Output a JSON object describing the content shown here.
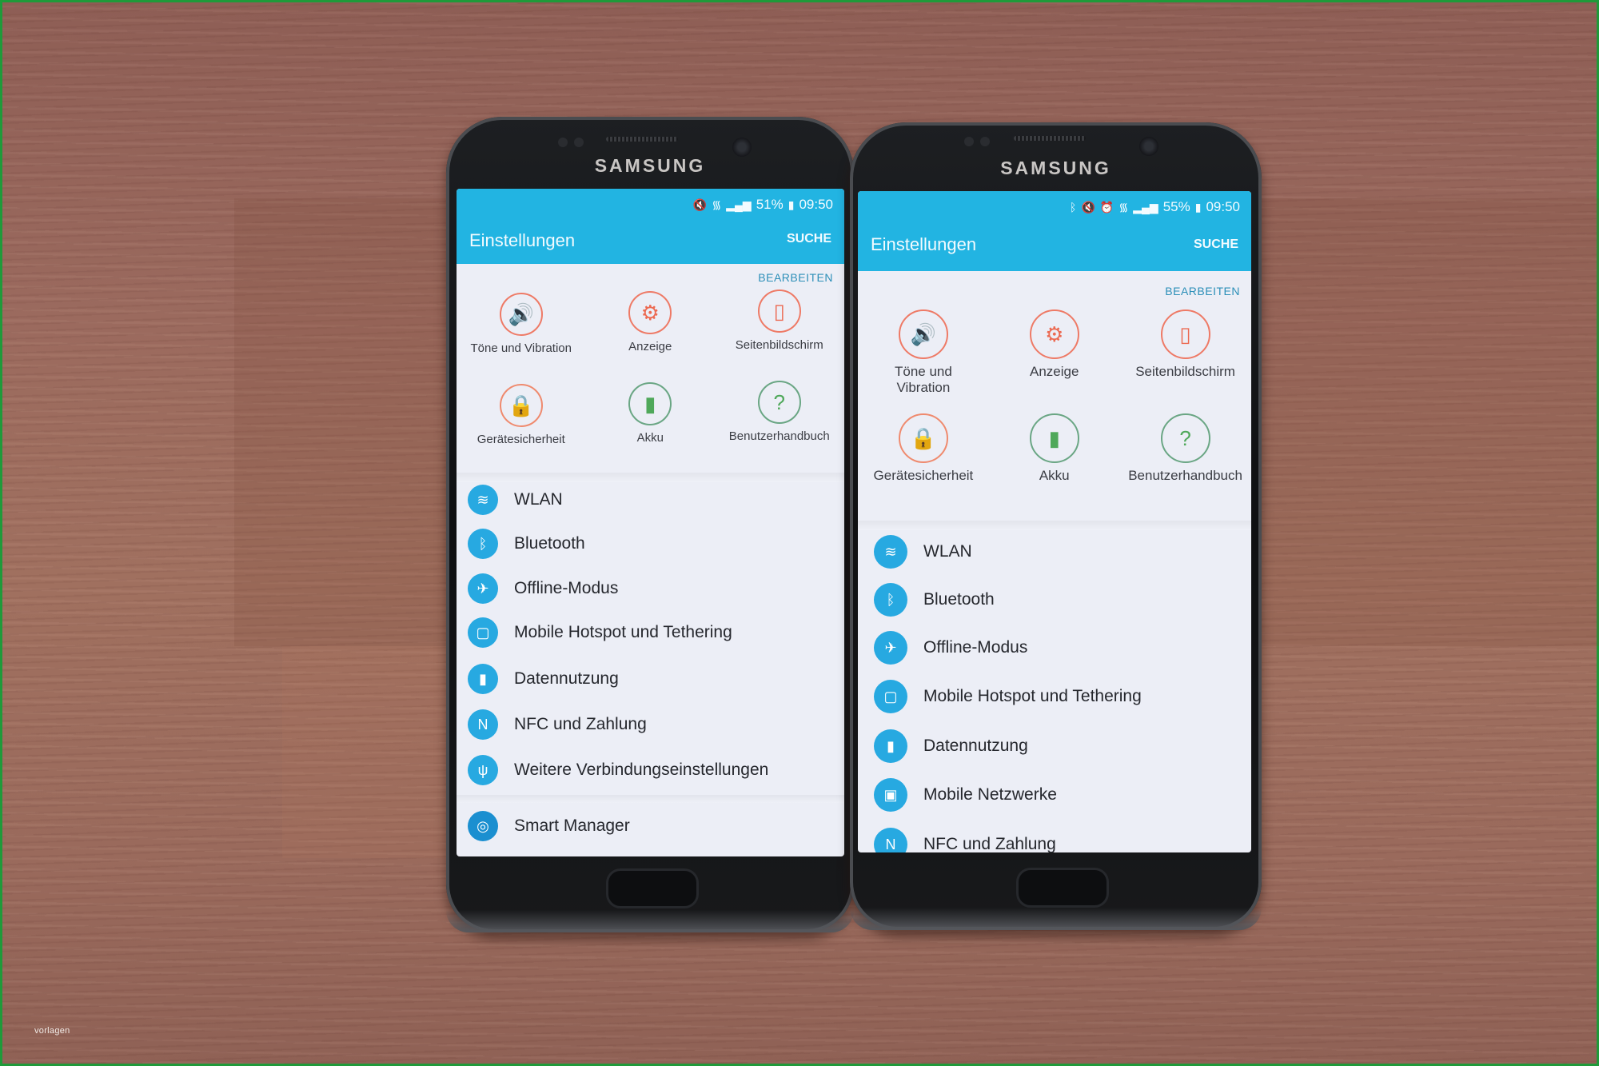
{
  "watermark": "vorlagen",
  "phones": [
    {
      "brand": "SAMSUNG",
      "status": {
        "icons": [
          "mute-icon",
          "wifi-icon",
          "signal-icon"
        ],
        "icon_glyphs": [
          "🔇",
          "᯾",
          "▂▄▆"
        ],
        "battery": "51%",
        "battery_icon": "▮",
        "time": "09:50"
      },
      "appbar": {
        "title": "Einstellungen",
        "search": "SUCHE"
      },
      "edit_label": "BEARBEITEN",
      "quick_settings": [
        {
          "label": "Töne und Vibration",
          "icon": "speaker-icon",
          "glyph": "🔊",
          "style": "orange"
        },
        {
          "label": "Anzeige",
          "icon": "display-icon",
          "glyph": "⚙",
          "style": "orange"
        },
        {
          "label": "Seitenbildschirm",
          "icon": "edge-screen-icon",
          "glyph": "▯",
          "style": "orange"
        },
        {
          "label": "Gerätesicherheit",
          "icon": "lock-icon",
          "glyph": "🔒",
          "style": "lockc"
        },
        {
          "label": "Akku",
          "icon": "battery-icon",
          "glyph": "▮",
          "style": "green"
        },
        {
          "label": "Benutzerhandbuch",
          "icon": "help-book-icon",
          "glyph": "?",
          "style": "green"
        }
      ],
      "settings": [
        {
          "label": "WLAN",
          "icon": "wifi-icon",
          "glyph": "≋"
        },
        {
          "label": "Bluetooth",
          "icon": "bluetooth-icon",
          "glyph": "ᛒ"
        },
        {
          "label": "Offline-Modus",
          "icon": "airplane-icon",
          "glyph": "✈"
        },
        {
          "label": "Mobile Hotspot und Tethering",
          "icon": "hotspot-icon",
          "glyph": "▢"
        },
        {
          "label": "Datennutzung",
          "icon": "data-usage-icon",
          "glyph": "▮"
        },
        {
          "label": "NFC und Zahlung",
          "icon": "nfc-icon",
          "glyph": "N"
        },
        {
          "label": "Weitere Verbindungseinstellungen",
          "icon": "antenna-icon",
          "glyph": "ψ"
        },
        {
          "label": "Smart Manager",
          "icon": "smart-manager-icon",
          "glyph": "◎"
        }
      ]
    },
    {
      "brand": "SAMSUNG",
      "status": {
        "icons": [
          "bluetooth-icon",
          "mute-icon",
          "alarm-icon",
          "wifi-icon",
          "signal-icon"
        ],
        "icon_glyphs": [
          "ᛒ",
          "🔇",
          "⏰",
          "᯾",
          "▂▄▆"
        ],
        "battery": "55%",
        "battery_icon": "▮",
        "time": "09:50"
      },
      "appbar": {
        "title": "Einstellungen",
        "search": "SUCHE"
      },
      "edit_label": "BEARBEITEN",
      "quick_settings": [
        {
          "label": "Töne und Vibration",
          "icon": "speaker-icon",
          "glyph": "🔊",
          "style": "orange"
        },
        {
          "label": "Anzeige",
          "icon": "display-icon",
          "glyph": "⚙",
          "style": "orange"
        },
        {
          "label": "Seitenbildschirm",
          "icon": "edge-screen-icon",
          "glyph": "▯",
          "style": "orange"
        },
        {
          "label": "Gerätesicherheit",
          "icon": "lock-icon",
          "glyph": "🔒",
          "style": "lockc"
        },
        {
          "label": "Akku",
          "icon": "battery-icon",
          "glyph": "▮",
          "style": "green"
        },
        {
          "label": "Benutzerhandbuch",
          "icon": "help-book-icon",
          "glyph": "?",
          "style": "green"
        }
      ],
      "settings": [
        {
          "label": "WLAN",
          "icon": "wifi-icon",
          "glyph": "≋"
        },
        {
          "label": "Bluetooth",
          "icon": "bluetooth-icon",
          "glyph": "ᛒ"
        },
        {
          "label": "Offline-Modus",
          "icon": "airplane-icon",
          "glyph": "✈"
        },
        {
          "label": "Mobile Hotspot und Tethering",
          "icon": "hotspot-icon",
          "glyph": "▢"
        },
        {
          "label": "Datennutzung",
          "icon": "data-usage-icon",
          "glyph": "▮"
        },
        {
          "label": "Mobile Netzwerke",
          "icon": "mobile-networks-icon",
          "glyph": "▣"
        },
        {
          "label": "NFC und Zahlung",
          "icon": "nfc-icon",
          "glyph": "N"
        }
      ]
    }
  ],
  "colors": {
    "header_blue": "#22b4e2",
    "list_icon_blue": "#27a9e1",
    "tile_orange": "#ec6a52",
    "tile_green": "#4fa85a",
    "edit_link": "#2c8fb8"
  }
}
